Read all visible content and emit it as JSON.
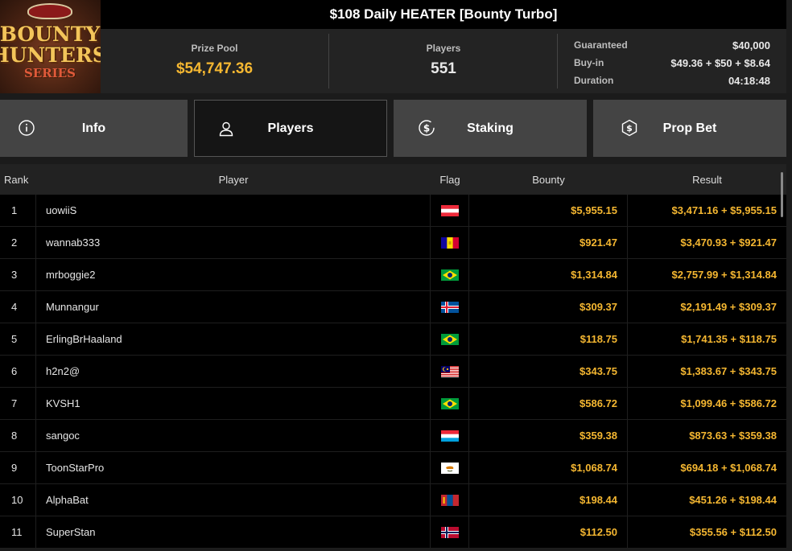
{
  "logo": {
    "line1": "BOUNTY",
    "line2": "HUNTERS",
    "line3": "SERIES"
  },
  "title": "$108 Daily HEATER [Bounty Turbo]",
  "prize_pool": {
    "label": "Prize Pool",
    "value": "$54,747.36"
  },
  "players_count": {
    "label": "Players",
    "value": "551"
  },
  "details": [
    {
      "key": "Guaranteed",
      "value": "$40,000"
    },
    {
      "key": "Buy-in",
      "value": "$49.36 + $50 + $8.64"
    },
    {
      "key": "Duration",
      "value": "04:18:48"
    }
  ],
  "tabs": [
    {
      "label": "Info",
      "icon": "info-icon"
    },
    {
      "label": "Players",
      "icon": "user-icon",
      "active": true
    },
    {
      "label": "Staking",
      "icon": "dollar-coin-icon"
    },
    {
      "label": "Prop Bet",
      "icon": "prop-bet-icon"
    }
  ],
  "table": {
    "headers": {
      "rank": "Rank",
      "player": "Player",
      "flag": "Flag",
      "bounty": "Bounty",
      "result": "Result"
    },
    "rows": [
      {
        "rank": "1",
        "player": "uowiiS",
        "flag": "austria",
        "bounty": "$5,955.15",
        "result": "$3,471.16 + $5,955.15"
      },
      {
        "rank": "2",
        "player": "wannab333",
        "flag": "andorra",
        "bounty": "$921.47",
        "result": "$3,470.93 + $921.47"
      },
      {
        "rank": "3",
        "player": "mrboggie2",
        "flag": "brazil",
        "bounty": "$1,314.84",
        "result": "$2,757.99 + $1,314.84"
      },
      {
        "rank": "4",
        "player": "Munnangur",
        "flag": "iceland",
        "bounty": "$309.37",
        "result": "$2,191.49 + $309.37"
      },
      {
        "rank": "5",
        "player": "ErlingBrHaaland",
        "flag": "brazil",
        "bounty": "$118.75",
        "result": "$1,741.35 + $118.75"
      },
      {
        "rank": "6",
        "player": "h2n2@",
        "flag": "malaysia",
        "bounty": "$343.75",
        "result": "$1,383.67 + $343.75"
      },
      {
        "rank": "7",
        "player": "KVSH1",
        "flag": "brazil",
        "bounty": "$586.72",
        "result": "$1,099.46 + $586.72"
      },
      {
        "rank": "8",
        "player": "sangoc",
        "flag": "luxembourg",
        "bounty": "$359.38",
        "result": "$873.63 + $359.38"
      },
      {
        "rank": "9",
        "player": "ToonStarPro",
        "flag": "cyprus",
        "bounty": "$1,068.74",
        "result": "$694.18 + $1,068.74"
      },
      {
        "rank": "10",
        "player": "AlphaBat",
        "flag": "mongolia",
        "bounty": "$198.44",
        "result": "$451.26 + $198.44"
      },
      {
        "rank": "11",
        "player": "SuperStan",
        "flag": "norway",
        "bounty": "$112.50",
        "result": "$355.56 + $112.50"
      }
    ]
  },
  "colors": {
    "accent": "#f5b731",
    "tab_bg": "#444444",
    "row_bg": "#000000"
  }
}
